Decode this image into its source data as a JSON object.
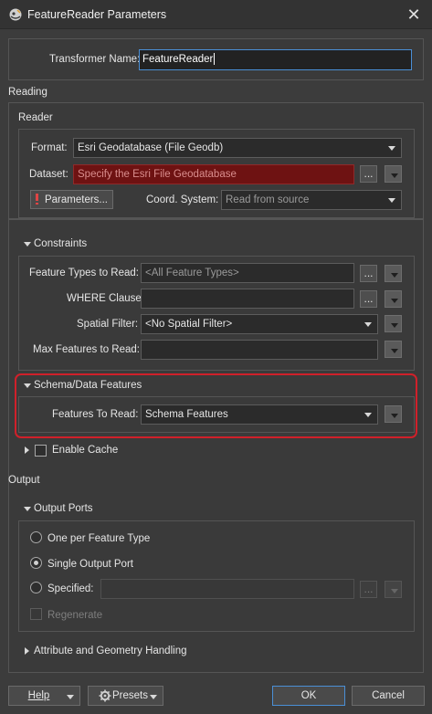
{
  "window": {
    "title": "FeatureReader Parameters",
    "close_symbol": "✕"
  },
  "transformer": {
    "label": "Transformer Name:",
    "value": "FeatureReader"
  },
  "reading": {
    "section_label": "Reading",
    "reader": {
      "label": "Reader",
      "format": {
        "label": "Format:",
        "value": "Esri Geodatabase (File Geodb)"
      },
      "dataset": {
        "label": "Dataset:",
        "placeholder": "Specify the Esri File Geodatabase"
      },
      "parameters_button": "Parameters...",
      "coord_system": {
        "label": "Coord. System:",
        "value": "Read from source"
      }
    },
    "constraints": {
      "label": "Constraints",
      "feature_types": {
        "label": "Feature Types to Read:",
        "value": "<All Feature Types>"
      },
      "where_clause": {
        "label": "WHERE Clause:",
        "value": ""
      },
      "spatial_filter": {
        "label": "Spatial Filter:",
        "value": "<No Spatial Filter>"
      },
      "max_features": {
        "label": "Max Features to Read:",
        "value": ""
      }
    },
    "schema": {
      "label": "Schema/Data Features",
      "features_to_read": {
        "label": "Features To Read:",
        "value": "Schema Features"
      }
    },
    "cache": {
      "label": "Enable Cache",
      "checked": false
    }
  },
  "output": {
    "section_label": "Output",
    "ports": {
      "label": "Output Ports",
      "options": [
        {
          "label": "One per Feature Type",
          "selected": false
        },
        {
          "label": "Single Output Port",
          "selected": true
        },
        {
          "label": "Specified:",
          "selected": false
        }
      ],
      "specified_value": "",
      "regenerate_label": "Regenerate"
    },
    "attr_geom": {
      "label": "Attribute and Geometry Handling"
    }
  },
  "buttons": {
    "dots": "...",
    "help": "Help",
    "presets": "Presets",
    "ok": "OK",
    "cancel": "Cancel"
  },
  "colors": {
    "background": "#3c3c3c",
    "field": "#2b2b2b",
    "error_field": "#6e1212",
    "highlight": "#d0202a",
    "focus": "#4a8fd6"
  }
}
